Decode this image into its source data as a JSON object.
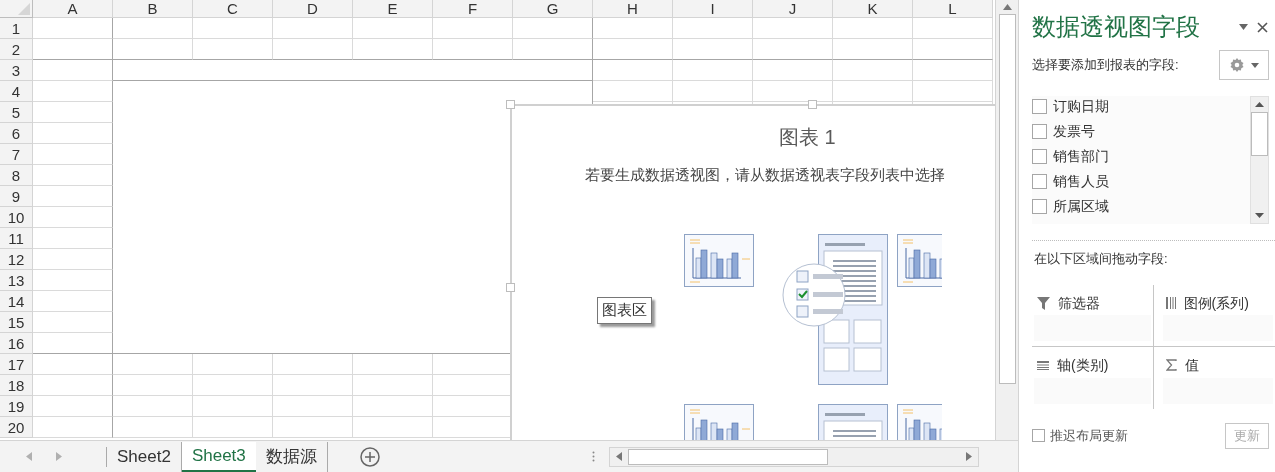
{
  "sheet": {
    "columns": [
      "A",
      "B",
      "C",
      "D",
      "E",
      "F",
      "G",
      "H",
      "I",
      "J",
      "K",
      "L"
    ],
    "rows": [
      "1",
      "2",
      "3",
      "4",
      "5",
      "6",
      "7",
      "8",
      "9",
      "10",
      "11",
      "12",
      "13",
      "14",
      "15",
      "16",
      "17",
      "18",
      "19",
      "20"
    ]
  },
  "chart": {
    "title": "图表 1",
    "hint": "若要生成数据透视图，请从数据透视表字段列表中选择",
    "tooltip": "图表区"
  },
  "sheet_tabs": [
    {
      "label": "Sheet2",
      "selected": false
    },
    {
      "label": "Sheet3",
      "selected": true
    },
    {
      "label": "数据源",
      "selected": false
    }
  ],
  "field_pane": {
    "title": "数据透视图字段",
    "choose_label": "选择要添加到报表的字段:",
    "fields": [
      {
        "label": "订购日期",
        "checked": false
      },
      {
        "label": "发票号",
        "checked": false
      },
      {
        "label": "销售部门",
        "checked": false
      },
      {
        "label": "销售人员",
        "checked": false
      },
      {
        "label": "所属区域",
        "checked": false
      }
    ],
    "drag_label": "在以下区域间拖动字段:",
    "areas": [
      {
        "kind": "filter",
        "label": "筛选器"
      },
      {
        "kind": "legend",
        "label": "图例(系列)"
      },
      {
        "kind": "axis",
        "label": "轴(类别)"
      },
      {
        "kind": "values",
        "label": "值"
      }
    ],
    "defer": {
      "label": "推迟布局更新",
      "checked": false
    },
    "update_button": "更新"
  }
}
